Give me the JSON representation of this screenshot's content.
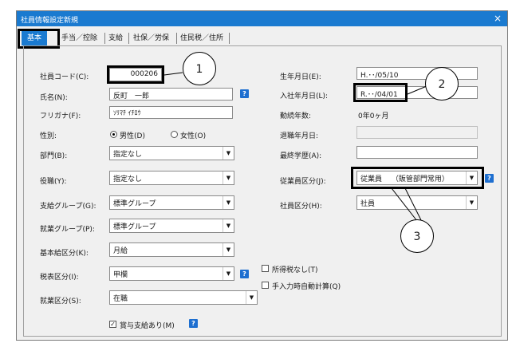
{
  "window": {
    "title": "社員情報設定新規",
    "close_label": "×"
  },
  "tabs": [
    "基本",
    "手当／控除",
    "支給",
    "社保／労保",
    "住民税／住所"
  ],
  "colors": {
    "accent": "#1a7ad0",
    "help": "#1e6fd0"
  },
  "left": {
    "employee_code_label": "社員コード(C):",
    "employee_code_value": "000206",
    "name_label": "氏名(N):",
    "name_value": "反町　一郎",
    "furigana_label": "フリガナ(F):",
    "furigana_value": "ｿﾘﾏﾁ ｲﾁﾛｳ",
    "gender_label": "性別:",
    "gender_male": "男性(D)",
    "gender_female": "女性(O)",
    "department_label": "部門(B):",
    "department_value": "指定なし",
    "position_label": "役職(Y):",
    "position_value": "指定なし",
    "pay_group_label": "支給グループ(G):",
    "pay_group_value": "標準グループ",
    "work_group_label": "就業グループ(P):",
    "work_group_value": "標準グループ",
    "base_pay_label": "基本給区分(K):",
    "base_pay_value": "月給",
    "tax_label": "税表区分(I):",
    "tax_value": "甲欄",
    "employment_label": "就業区分(S):",
    "employment_value": "在職",
    "bonus_label": "賞与支給あり(M)"
  },
  "right": {
    "birthdate_label": "生年月日(E):",
    "birthdate_value": "H.･･/05/10",
    "hire_date_label": "入社年月日(L):",
    "hire_date_value": "R.･･/04/01",
    "service_label": "勤続年数:",
    "service_value": "0年0ヶ月",
    "retire_label": "退職年月日:",
    "education_label": "最終学歴(A):",
    "emp_class_label": "従業員区分(J):",
    "emp_class_value": "従業員　 （販管部門常用）",
    "staff_class_label": "社員区分(H):",
    "staff_class_value": "社員"
  },
  "checks": {
    "no_income_tax": "所得税なし(T)",
    "manual_auto_calc": "手入力時自動計算(Q)"
  },
  "help_glyph": "?",
  "check_glyph": "✓",
  "dropdown_glyph": "▼",
  "callouts": [
    "1",
    "2",
    "3"
  ]
}
